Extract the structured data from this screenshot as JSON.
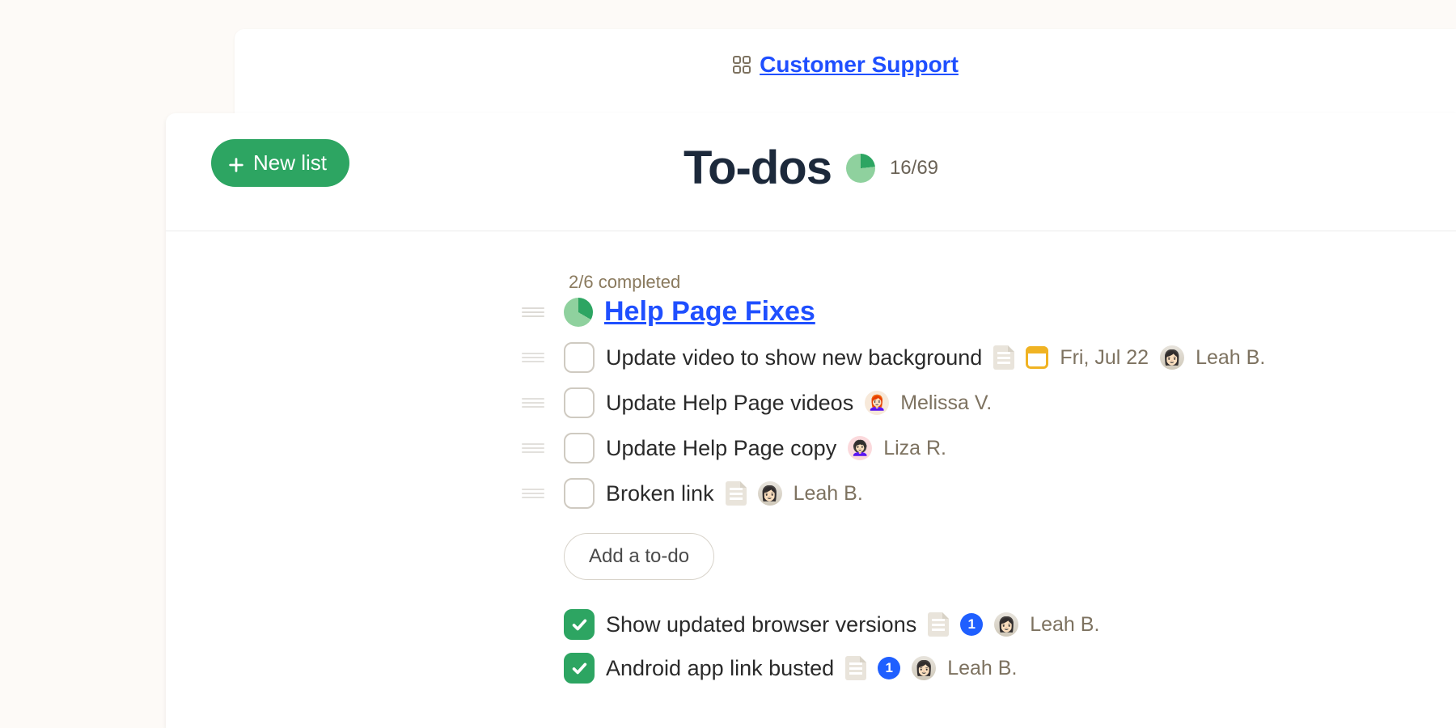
{
  "breadcrumb": {
    "label": "Customer Support"
  },
  "header": {
    "new_list_label": "New list",
    "page_title": "To-dos",
    "done": 16,
    "total": 69,
    "count_text": "16/69"
  },
  "list": {
    "meta": "2/6 completed",
    "done": 2,
    "total": 6,
    "title": "Help Page Fixes",
    "add_label": "Add a to-do",
    "todos": [
      {
        "title": "Update video to show new background",
        "has_note": true,
        "due": "Fri, Jul 22",
        "assignee": "Leah B.",
        "avatar": "leah"
      },
      {
        "title": "Update Help Page videos",
        "has_note": false,
        "assignee": "Melissa V.",
        "avatar": "melissa"
      },
      {
        "title": "Update Help Page copy",
        "has_note": false,
        "assignee": "Liza R.",
        "avatar": "liza"
      },
      {
        "title": "Broken link",
        "has_note": true,
        "assignee": "Leah B.",
        "avatar": "leah"
      }
    ],
    "completed": [
      {
        "title": "Show updated browser versions",
        "has_note": true,
        "comments": 1,
        "assignee": "Leah B.",
        "avatar": "leah"
      },
      {
        "title": "Android app link busted",
        "has_note": true,
        "comments": 1,
        "assignee": "Leah B.",
        "avatar": "leah"
      }
    ]
  },
  "colors": {
    "green": "#2da562",
    "green_light": "#8fd19e",
    "link_blue": "#1f4fff"
  }
}
